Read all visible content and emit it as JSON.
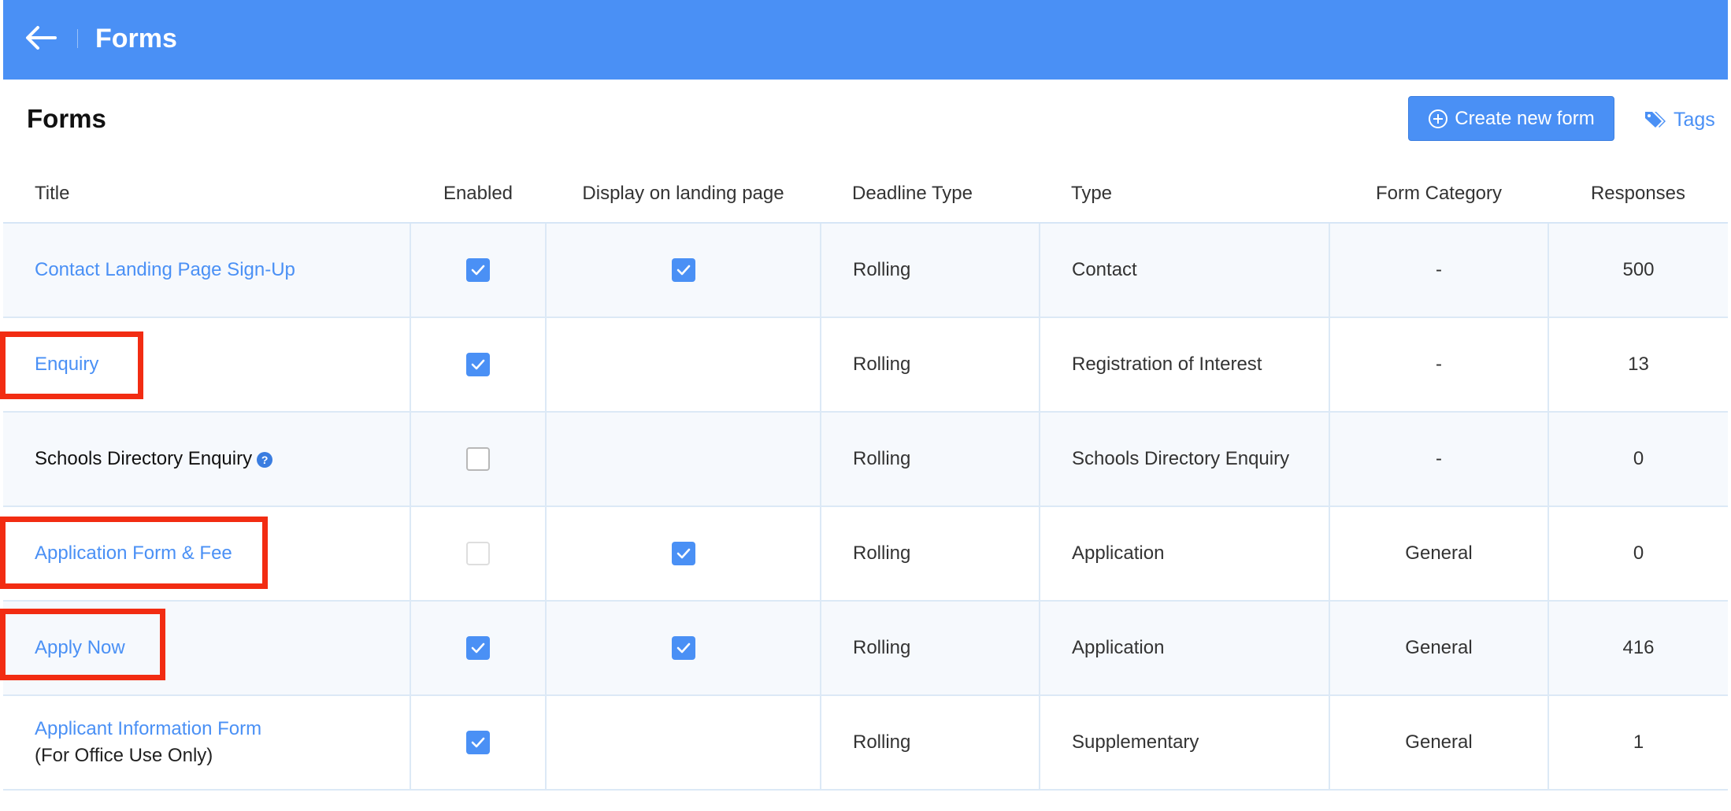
{
  "header": {
    "title": "Forms",
    "back_icon": "arrow-left-icon"
  },
  "page": {
    "title": "Forms"
  },
  "toolbar": {
    "create_label": "Create new form",
    "create_icon": "plus-circle-icon",
    "tags_label": "Tags",
    "tags_icon": "tags-icon"
  },
  "colors": {
    "accent": "#4a90f5",
    "highlight": "#f22c12"
  },
  "table": {
    "columns": [
      "Title",
      "Enabled",
      "Display on landing page",
      "Deadline Type",
      "Type",
      "Form Category",
      "Responses"
    ],
    "rows": [
      {
        "title": "Contact Landing Page Sign-Up",
        "subtitle": "",
        "is_link": true,
        "help": false,
        "enabled": "checked",
        "display_on_landing": true,
        "deadline_type": "Rolling",
        "type": "Contact",
        "category": "-",
        "responses": "500"
      },
      {
        "title": "Enquiry",
        "subtitle": "",
        "is_link": true,
        "help": false,
        "enabled": "checked",
        "display_on_landing": false,
        "deadline_type": "Rolling",
        "type": "Registration of Interest",
        "category": "-",
        "responses": "13"
      },
      {
        "title": "Schools Directory Enquiry",
        "subtitle": "",
        "is_link": false,
        "help": true,
        "enabled": "unchecked",
        "display_on_landing": false,
        "deadline_type": "Rolling",
        "type": "Schools Directory Enquiry",
        "category": "-",
        "responses": "0"
      },
      {
        "title": "Application Form & Fee",
        "subtitle": "",
        "is_link": true,
        "help": false,
        "enabled": "disabled",
        "display_on_landing": true,
        "deadline_type": "Rolling",
        "type": "Application",
        "category": "General",
        "responses": "0"
      },
      {
        "title": "Apply Now",
        "subtitle": "",
        "is_link": true,
        "help": false,
        "enabled": "checked",
        "display_on_landing": true,
        "deadline_type": "Rolling",
        "type": "Application",
        "category": "General",
        "responses": "416"
      },
      {
        "title": "Applicant Information Form",
        "subtitle": "(For Office Use Only)",
        "is_link": true,
        "help": false,
        "enabled": "checked",
        "display_on_landing": false,
        "deadline_type": "Rolling",
        "type": "Supplementary",
        "category": "General",
        "responses": "1"
      }
    ]
  }
}
